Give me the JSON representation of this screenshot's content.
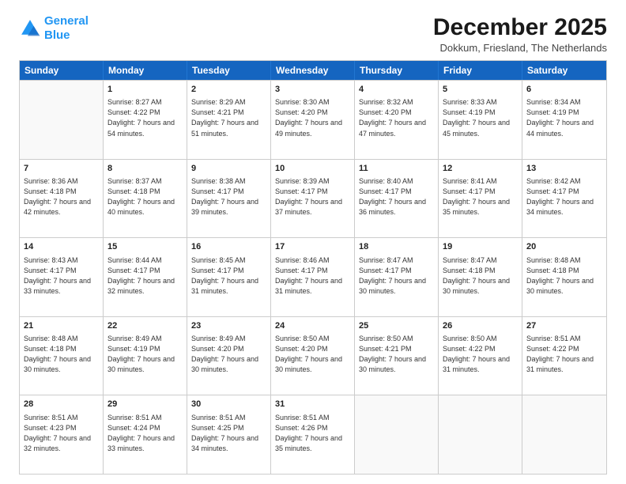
{
  "logo": {
    "line1": "General",
    "line2": "Blue"
  },
  "title": "December 2025",
  "subtitle": "Dokkum, Friesland, The Netherlands",
  "header_days": [
    "Sunday",
    "Monday",
    "Tuesday",
    "Wednesday",
    "Thursday",
    "Friday",
    "Saturday"
  ],
  "rows": [
    [
      {
        "day": "",
        "empty": true
      },
      {
        "day": "1",
        "sunrise": "Sunrise: 8:27 AM",
        "sunset": "Sunset: 4:22 PM",
        "daylight": "Daylight: 7 hours and 54 minutes."
      },
      {
        "day": "2",
        "sunrise": "Sunrise: 8:29 AM",
        "sunset": "Sunset: 4:21 PM",
        "daylight": "Daylight: 7 hours and 51 minutes."
      },
      {
        "day": "3",
        "sunrise": "Sunrise: 8:30 AM",
        "sunset": "Sunset: 4:20 PM",
        "daylight": "Daylight: 7 hours and 49 minutes."
      },
      {
        "day": "4",
        "sunrise": "Sunrise: 8:32 AM",
        "sunset": "Sunset: 4:20 PM",
        "daylight": "Daylight: 7 hours and 47 minutes."
      },
      {
        "day": "5",
        "sunrise": "Sunrise: 8:33 AM",
        "sunset": "Sunset: 4:19 PM",
        "daylight": "Daylight: 7 hours and 45 minutes."
      },
      {
        "day": "6",
        "sunrise": "Sunrise: 8:34 AM",
        "sunset": "Sunset: 4:19 PM",
        "daylight": "Daylight: 7 hours and 44 minutes."
      }
    ],
    [
      {
        "day": "7",
        "sunrise": "Sunrise: 8:36 AM",
        "sunset": "Sunset: 4:18 PM",
        "daylight": "Daylight: 7 hours and 42 minutes."
      },
      {
        "day": "8",
        "sunrise": "Sunrise: 8:37 AM",
        "sunset": "Sunset: 4:18 PM",
        "daylight": "Daylight: 7 hours and 40 minutes."
      },
      {
        "day": "9",
        "sunrise": "Sunrise: 8:38 AM",
        "sunset": "Sunset: 4:17 PM",
        "daylight": "Daylight: 7 hours and 39 minutes."
      },
      {
        "day": "10",
        "sunrise": "Sunrise: 8:39 AM",
        "sunset": "Sunset: 4:17 PM",
        "daylight": "Daylight: 7 hours and 37 minutes."
      },
      {
        "day": "11",
        "sunrise": "Sunrise: 8:40 AM",
        "sunset": "Sunset: 4:17 PM",
        "daylight": "Daylight: 7 hours and 36 minutes."
      },
      {
        "day": "12",
        "sunrise": "Sunrise: 8:41 AM",
        "sunset": "Sunset: 4:17 PM",
        "daylight": "Daylight: 7 hours and 35 minutes."
      },
      {
        "day": "13",
        "sunrise": "Sunrise: 8:42 AM",
        "sunset": "Sunset: 4:17 PM",
        "daylight": "Daylight: 7 hours and 34 minutes."
      }
    ],
    [
      {
        "day": "14",
        "sunrise": "Sunrise: 8:43 AM",
        "sunset": "Sunset: 4:17 PM",
        "daylight": "Daylight: 7 hours and 33 minutes."
      },
      {
        "day": "15",
        "sunrise": "Sunrise: 8:44 AM",
        "sunset": "Sunset: 4:17 PM",
        "daylight": "Daylight: 7 hours and 32 minutes."
      },
      {
        "day": "16",
        "sunrise": "Sunrise: 8:45 AM",
        "sunset": "Sunset: 4:17 PM",
        "daylight": "Daylight: 7 hours and 31 minutes."
      },
      {
        "day": "17",
        "sunrise": "Sunrise: 8:46 AM",
        "sunset": "Sunset: 4:17 PM",
        "daylight": "Daylight: 7 hours and 31 minutes."
      },
      {
        "day": "18",
        "sunrise": "Sunrise: 8:47 AM",
        "sunset": "Sunset: 4:17 PM",
        "daylight": "Daylight: 7 hours and 30 minutes."
      },
      {
        "day": "19",
        "sunrise": "Sunrise: 8:47 AM",
        "sunset": "Sunset: 4:18 PM",
        "daylight": "Daylight: 7 hours and 30 minutes."
      },
      {
        "day": "20",
        "sunrise": "Sunrise: 8:48 AM",
        "sunset": "Sunset: 4:18 PM",
        "daylight": "Daylight: 7 hours and 30 minutes."
      }
    ],
    [
      {
        "day": "21",
        "sunrise": "Sunrise: 8:48 AM",
        "sunset": "Sunset: 4:18 PM",
        "daylight": "Daylight: 7 hours and 30 minutes."
      },
      {
        "day": "22",
        "sunrise": "Sunrise: 8:49 AM",
        "sunset": "Sunset: 4:19 PM",
        "daylight": "Daylight: 7 hours and 30 minutes."
      },
      {
        "day": "23",
        "sunrise": "Sunrise: 8:49 AM",
        "sunset": "Sunset: 4:20 PM",
        "daylight": "Daylight: 7 hours and 30 minutes."
      },
      {
        "day": "24",
        "sunrise": "Sunrise: 8:50 AM",
        "sunset": "Sunset: 4:20 PM",
        "daylight": "Daylight: 7 hours and 30 minutes."
      },
      {
        "day": "25",
        "sunrise": "Sunrise: 8:50 AM",
        "sunset": "Sunset: 4:21 PM",
        "daylight": "Daylight: 7 hours and 30 minutes."
      },
      {
        "day": "26",
        "sunrise": "Sunrise: 8:50 AM",
        "sunset": "Sunset: 4:22 PM",
        "daylight": "Daylight: 7 hours and 31 minutes."
      },
      {
        "day": "27",
        "sunrise": "Sunrise: 8:51 AM",
        "sunset": "Sunset: 4:22 PM",
        "daylight": "Daylight: 7 hours and 31 minutes."
      }
    ],
    [
      {
        "day": "28",
        "sunrise": "Sunrise: 8:51 AM",
        "sunset": "Sunset: 4:23 PM",
        "daylight": "Daylight: 7 hours and 32 minutes."
      },
      {
        "day": "29",
        "sunrise": "Sunrise: 8:51 AM",
        "sunset": "Sunset: 4:24 PM",
        "daylight": "Daylight: 7 hours and 33 minutes."
      },
      {
        "day": "30",
        "sunrise": "Sunrise: 8:51 AM",
        "sunset": "Sunset: 4:25 PM",
        "daylight": "Daylight: 7 hours and 34 minutes."
      },
      {
        "day": "31",
        "sunrise": "Sunrise: 8:51 AM",
        "sunset": "Sunset: 4:26 PM",
        "daylight": "Daylight: 7 hours and 35 minutes."
      },
      {
        "day": "",
        "empty": true
      },
      {
        "day": "",
        "empty": true
      },
      {
        "day": "",
        "empty": true
      }
    ]
  ]
}
